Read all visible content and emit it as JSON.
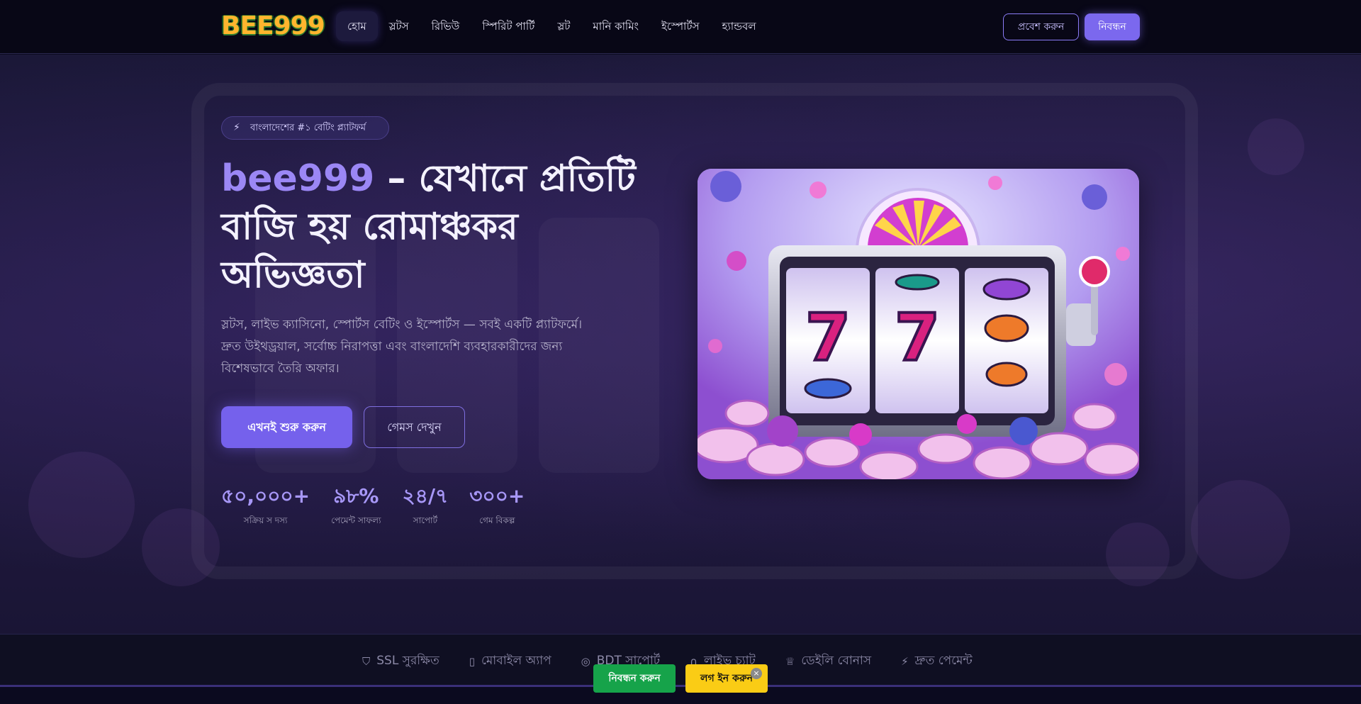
{
  "header": {
    "logo": "BEE999",
    "nav": [
      "হোম",
      "স্লটস",
      "রিভিউ",
      "স্পিরিট পার্টি",
      "স্লট",
      "মানি কামিং",
      "ইস্পোর্টস",
      "হ্যান্ডবল"
    ],
    "login_label": "প্রবেশ করুন",
    "register_label": "নিবন্ধন"
  },
  "hero": {
    "badge": "বাংলাদেশের #১ বেটিং প্ল্যাটফর্ম",
    "badge_icon": "lightning-icon",
    "title_brand": "bee999",
    "title_rest": " – যেখানে প্রতিটি বাজি হয় রোমাঞ্চকর অভিজ্ঞতা",
    "description": "স্লটস, লাইভ ক্যাসিনো, স্পোর্টস বেটিং ও ইস্পোর্টস — সবই একটি প্ল্যাটফর্মে। দ্রুত উইথড্রয়াল, সর্বোচ্চ নিরাপত্তা এবং বাংলাদেশি ব্যবহারকারীদের জন্য বিশেষভাবে তৈরি অফার।",
    "start_label": "এখনই শুরু করুন",
    "games_label": "গেমস দেখুন",
    "stats": [
      {
        "value": "৫০,০০০+",
        "label": "সক্রিয় স দস্য"
      },
      {
        "value": "৯৮%",
        "label": "পেমেন্ট সাফল্য"
      },
      {
        "value": "২৪/৭",
        "label": "সাপোর্ট"
      },
      {
        "value": "৩০০+",
        "label": "গেম বিকল্প"
      }
    ]
  },
  "features": [
    {
      "icon": "shield-icon",
      "label": "SSL সুরক্ষিত"
    },
    {
      "icon": "mobile-icon",
      "label": "মোবাইল অ্যাপ"
    },
    {
      "icon": "coins-icon",
      "label": "BDT সাপোর্ট"
    },
    {
      "icon": "headset-icon",
      "label": "লাইভ চ্যাট"
    },
    {
      "icon": "trophy-icon",
      "label": "ডেইলি বোনাস"
    },
    {
      "icon": "lightning-icon",
      "label": "দ্রুত পেমেন্ট"
    }
  ],
  "floating": {
    "register_label": "নিবন্ধন করুন",
    "login_label": "লগ ইন করুন",
    "close_label": "×"
  },
  "colors": {
    "accent": "#7561ec",
    "brand_text": "#9b87f5",
    "register_green": "#16a34a",
    "login_yellow": "#facc15"
  }
}
